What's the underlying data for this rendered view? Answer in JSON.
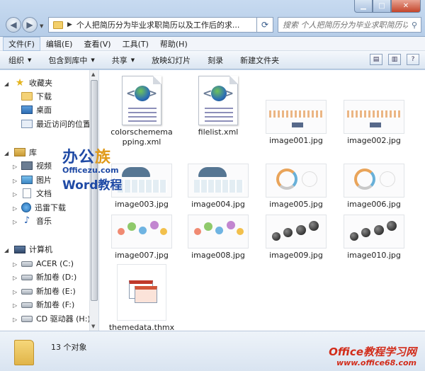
{
  "window": {
    "address_path": "个人把简历分为毕业求职简历以及工作后的求...",
    "search_placeholder": "搜索 个人把简历分为毕业求职简历以...",
    "minimize_icon": "minimize-icon",
    "maximize_icon": "maximize-icon",
    "close_icon": "close-icon"
  },
  "menu": [
    "文件(F)",
    "编辑(E)",
    "查看(V)",
    "工具(T)",
    "帮助(H)"
  ],
  "toolbar": {
    "organize": "组织",
    "include_library": "包含到库中",
    "share": "共享",
    "slideshow": "放映幻灯片",
    "burn": "刻录",
    "new_folder": "新建文件夹"
  },
  "sidebar": {
    "favorites": "收藏夹",
    "downloads": "下载",
    "desktop": "桌面",
    "recent": "最近访问的位置",
    "libraries": "库",
    "videos": "视频",
    "pictures": "图片",
    "documents": "文档",
    "thunder": "迅雷下载",
    "music": "音乐",
    "computer": "计算机",
    "drive_c": "ACER (C:)",
    "drive_d": "新加卷 (D:)",
    "drive_e": "新加卷 (E:)",
    "drive_f": "新加卷 (F:)",
    "drive_h": "CD 驱动器 (H:) C"
  },
  "files": [
    {
      "name": "colorschemema pping.xml"
    },
    {
      "name": "filelist.xml"
    },
    {
      "name": "image001.jpg"
    },
    {
      "name": "image002.jpg"
    },
    {
      "name": "image003.jpg"
    },
    {
      "name": "image004.jpg"
    },
    {
      "name": "image005.jpg"
    },
    {
      "name": "image006.jpg"
    },
    {
      "name": "image007.jpg"
    },
    {
      "name": "image008.jpg"
    },
    {
      "name": "image009.jpg"
    },
    {
      "name": "image010.jpg"
    },
    {
      "name": "themedata.thmx"
    }
  ],
  "watermark": {
    "brand_a": "办公",
    "brand_b": "族",
    "brand_url": "Officezu.com",
    "brand_word": "Word教程",
    "site_name": "Office教程学习网",
    "site_url": "www.office68.com"
  },
  "status": {
    "count": "13 个对象"
  }
}
